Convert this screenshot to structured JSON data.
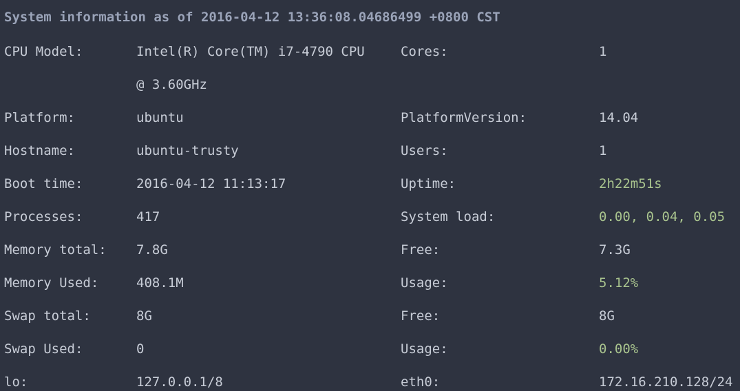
{
  "heading": "System information as of 2016-04-12 13:36:08.04686499 +0800 CST",
  "colors": {
    "background": "#2e3340",
    "text": "#c7ccd6",
    "heading": "#9aa3b8",
    "highlight": "#a9c48e"
  },
  "rows": [
    {
      "label": "CPU Model:",
      "value": "Intel(R) Core(TM) i7-4790 CPU",
      "label2": "Cores:",
      "value2": "1"
    },
    {
      "label": "",
      "value": "@ 3.60GHz",
      "label2": "",
      "value2": ""
    },
    {
      "label": "Platform:",
      "value": "ubuntu",
      "label2": "PlatformVersion:",
      "value2": "14.04"
    },
    {
      "label": "Hostname:",
      "value": "ubuntu-trusty",
      "label2": "Users:",
      "value2": "1"
    },
    {
      "label": "Boot time:",
      "value": "2016-04-12 11:13:17",
      "label2": "Uptime:",
      "value2": "2h22m51s"
    },
    {
      "label": "Processes:",
      "value": "417",
      "label2": "System load:",
      "value2": "0.00, 0.04, 0.05"
    },
    {
      "label": "Memory total:",
      "value": "7.8G",
      "label2": "Free:",
      "value2": "7.3G"
    },
    {
      "label": "Memory Used:",
      "value": "408.1M",
      "label2": "Usage:",
      "value2": "5.12%"
    },
    {
      "label": "Swap total:",
      "value": "8G",
      "label2": "Free:",
      "value2": "8G"
    },
    {
      "label": "Swap Used:",
      "value": "0",
      "label2": "Usage:",
      "value2": "0.00%"
    },
    {
      "label": "lo:",
      "value": "127.0.0.1/8",
      "label2": "eth0:",
      "value2": "172.16.210.128/24"
    }
  ]
}
